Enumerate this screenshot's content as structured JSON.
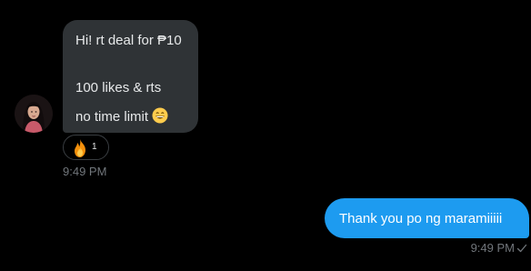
{
  "incoming": {
    "lines": [
      "Hi! rt deal for ₱10",
      "100 likes & rts",
      "no time limit"
    ],
    "emoji": "grinning-face-icon",
    "reaction": {
      "emoji": "fire-icon",
      "count": "1"
    },
    "time": "9:49 PM"
  },
  "outgoing": {
    "text": "Thank you po ng maramiiiii",
    "time": "9:49 PM",
    "status_icon": "checkmark-icon"
  },
  "colors": {
    "background": "#000000",
    "incoming_bubble": "#2f3336",
    "outgoing_bubble": "#1d9bf0",
    "timestamp": "#71767b"
  }
}
